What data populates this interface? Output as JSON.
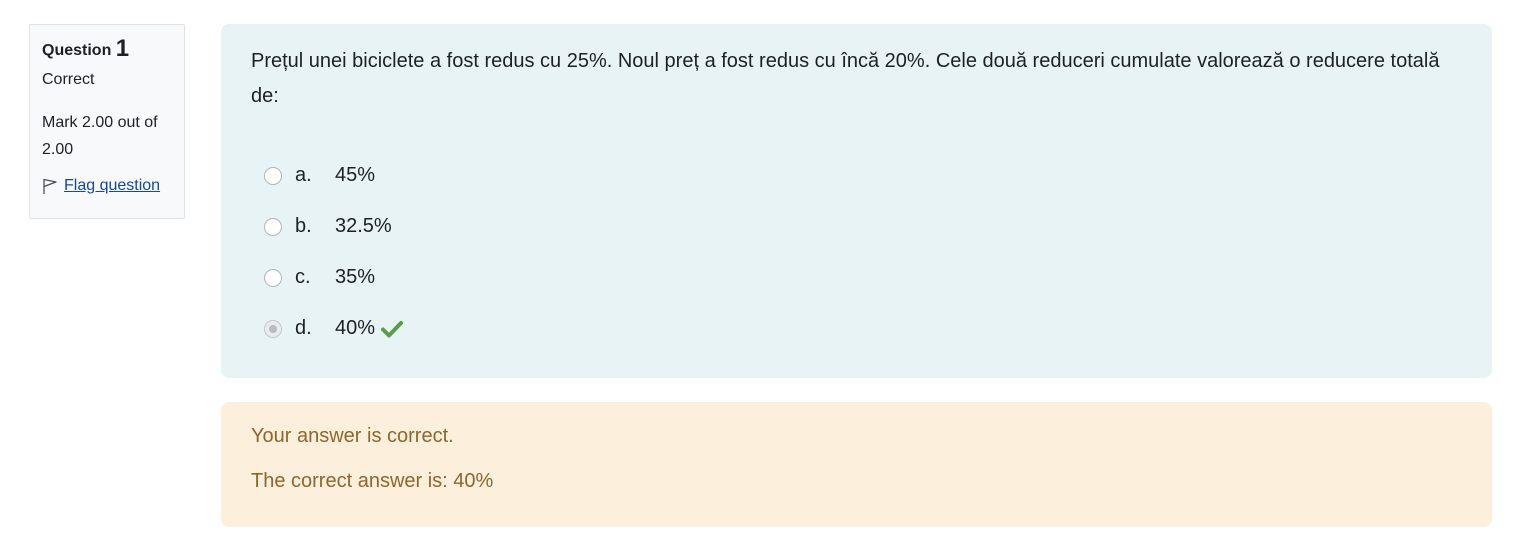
{
  "info": {
    "question_label": "Question",
    "question_number": "1",
    "state": "Correct",
    "grade": "Mark 2.00 out of 2.00",
    "flag_label": "Flag question"
  },
  "question": {
    "text": "Prețul unei biciclete a fost redus cu 25%. Noul preț a fost redus cu încă 20%. Cele două reduceri cumulate valorează o reducere totală de:",
    "options": [
      {
        "letter": "a.",
        "text": "45%",
        "selected": false
      },
      {
        "letter": "b.",
        "text": "32.5%",
        "selected": false
      },
      {
        "letter": "c.",
        "text": "35%",
        "selected": false
      },
      {
        "letter": "d.",
        "text": "40%",
        "selected": true,
        "marked_correct": true
      }
    ]
  },
  "feedback": {
    "result": "Your answer is correct.",
    "right_answer": "The correct answer is: 40%"
  },
  "colors": {
    "content_bg": "#e7f3f5",
    "feedback_bg": "#fcefdc",
    "feedback_text": "#8e662e",
    "check_icon": "#5a9e47",
    "link": "#0f47ad"
  },
  "icons": {
    "flag": "flag-icon",
    "correct": "check-icon"
  }
}
